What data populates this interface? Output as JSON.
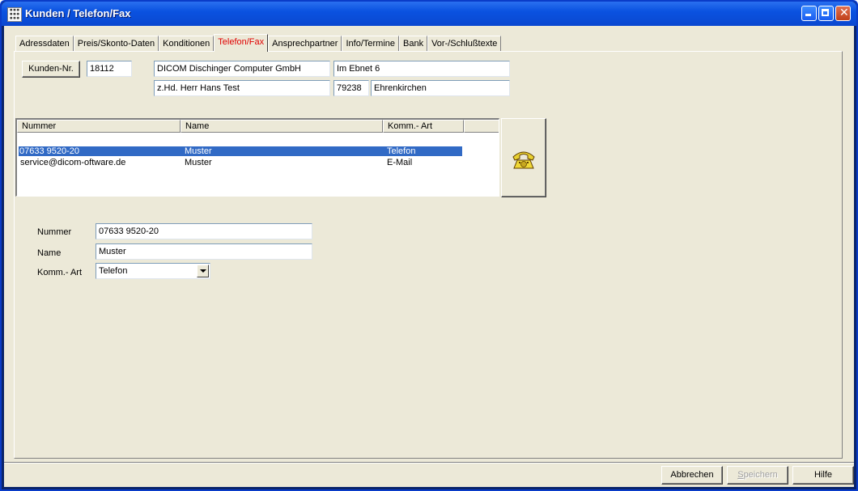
{
  "window": {
    "title": "Kunden / Telefon/Fax"
  },
  "tabs": [
    {
      "label": "Adressdaten"
    },
    {
      "label": "Preis/Skonto-Daten"
    },
    {
      "label": "Konditionen"
    },
    {
      "label": "Telefon/Fax",
      "active": true
    },
    {
      "label": "Ansprechpartner"
    },
    {
      "label": "Info/Termine"
    },
    {
      "label": "Bank"
    },
    {
      "label": "Vor-/Schlußtexte"
    }
  ],
  "customer": {
    "button_label": "Kunden-Nr.",
    "number": "18112",
    "company": "DICOM Dischinger Computer GmbH",
    "street": "Im Ebnet 6",
    "attention": "z.Hd. Herr Hans Test",
    "zip": "79238",
    "city": "Ehrenkirchen"
  },
  "list": {
    "headers": [
      "Nummer",
      "Name",
      "Komm.- Art"
    ],
    "rows": [
      {
        "nummer": "07633 9520-20",
        "name": "Muster",
        "art": "Telefon",
        "selected": true
      },
      {
        "nummer": "service@dicom-oftware.de",
        "name": "Muster",
        "art": "E-Mail",
        "selected": false
      }
    ]
  },
  "detail": {
    "nummer_label": "Nummer",
    "nummer_value": "07633 9520-20",
    "name_label": "Name",
    "name_value": "Muster",
    "art_label": "Komm.- Art",
    "art_value": "Telefon"
  },
  "footer": {
    "cancel": "Abbrechen",
    "save_prefix": "",
    "save_underline": "S",
    "save_rest": "peichern",
    "help": "Hilfe"
  },
  "icons": {
    "phone": "telephone-icon",
    "app": "app-icon"
  },
  "colors": {
    "titlebar": "#0a52e0",
    "selection": "#316ac5",
    "active_tab_text": "#e00000",
    "face": "#ece9d8"
  }
}
